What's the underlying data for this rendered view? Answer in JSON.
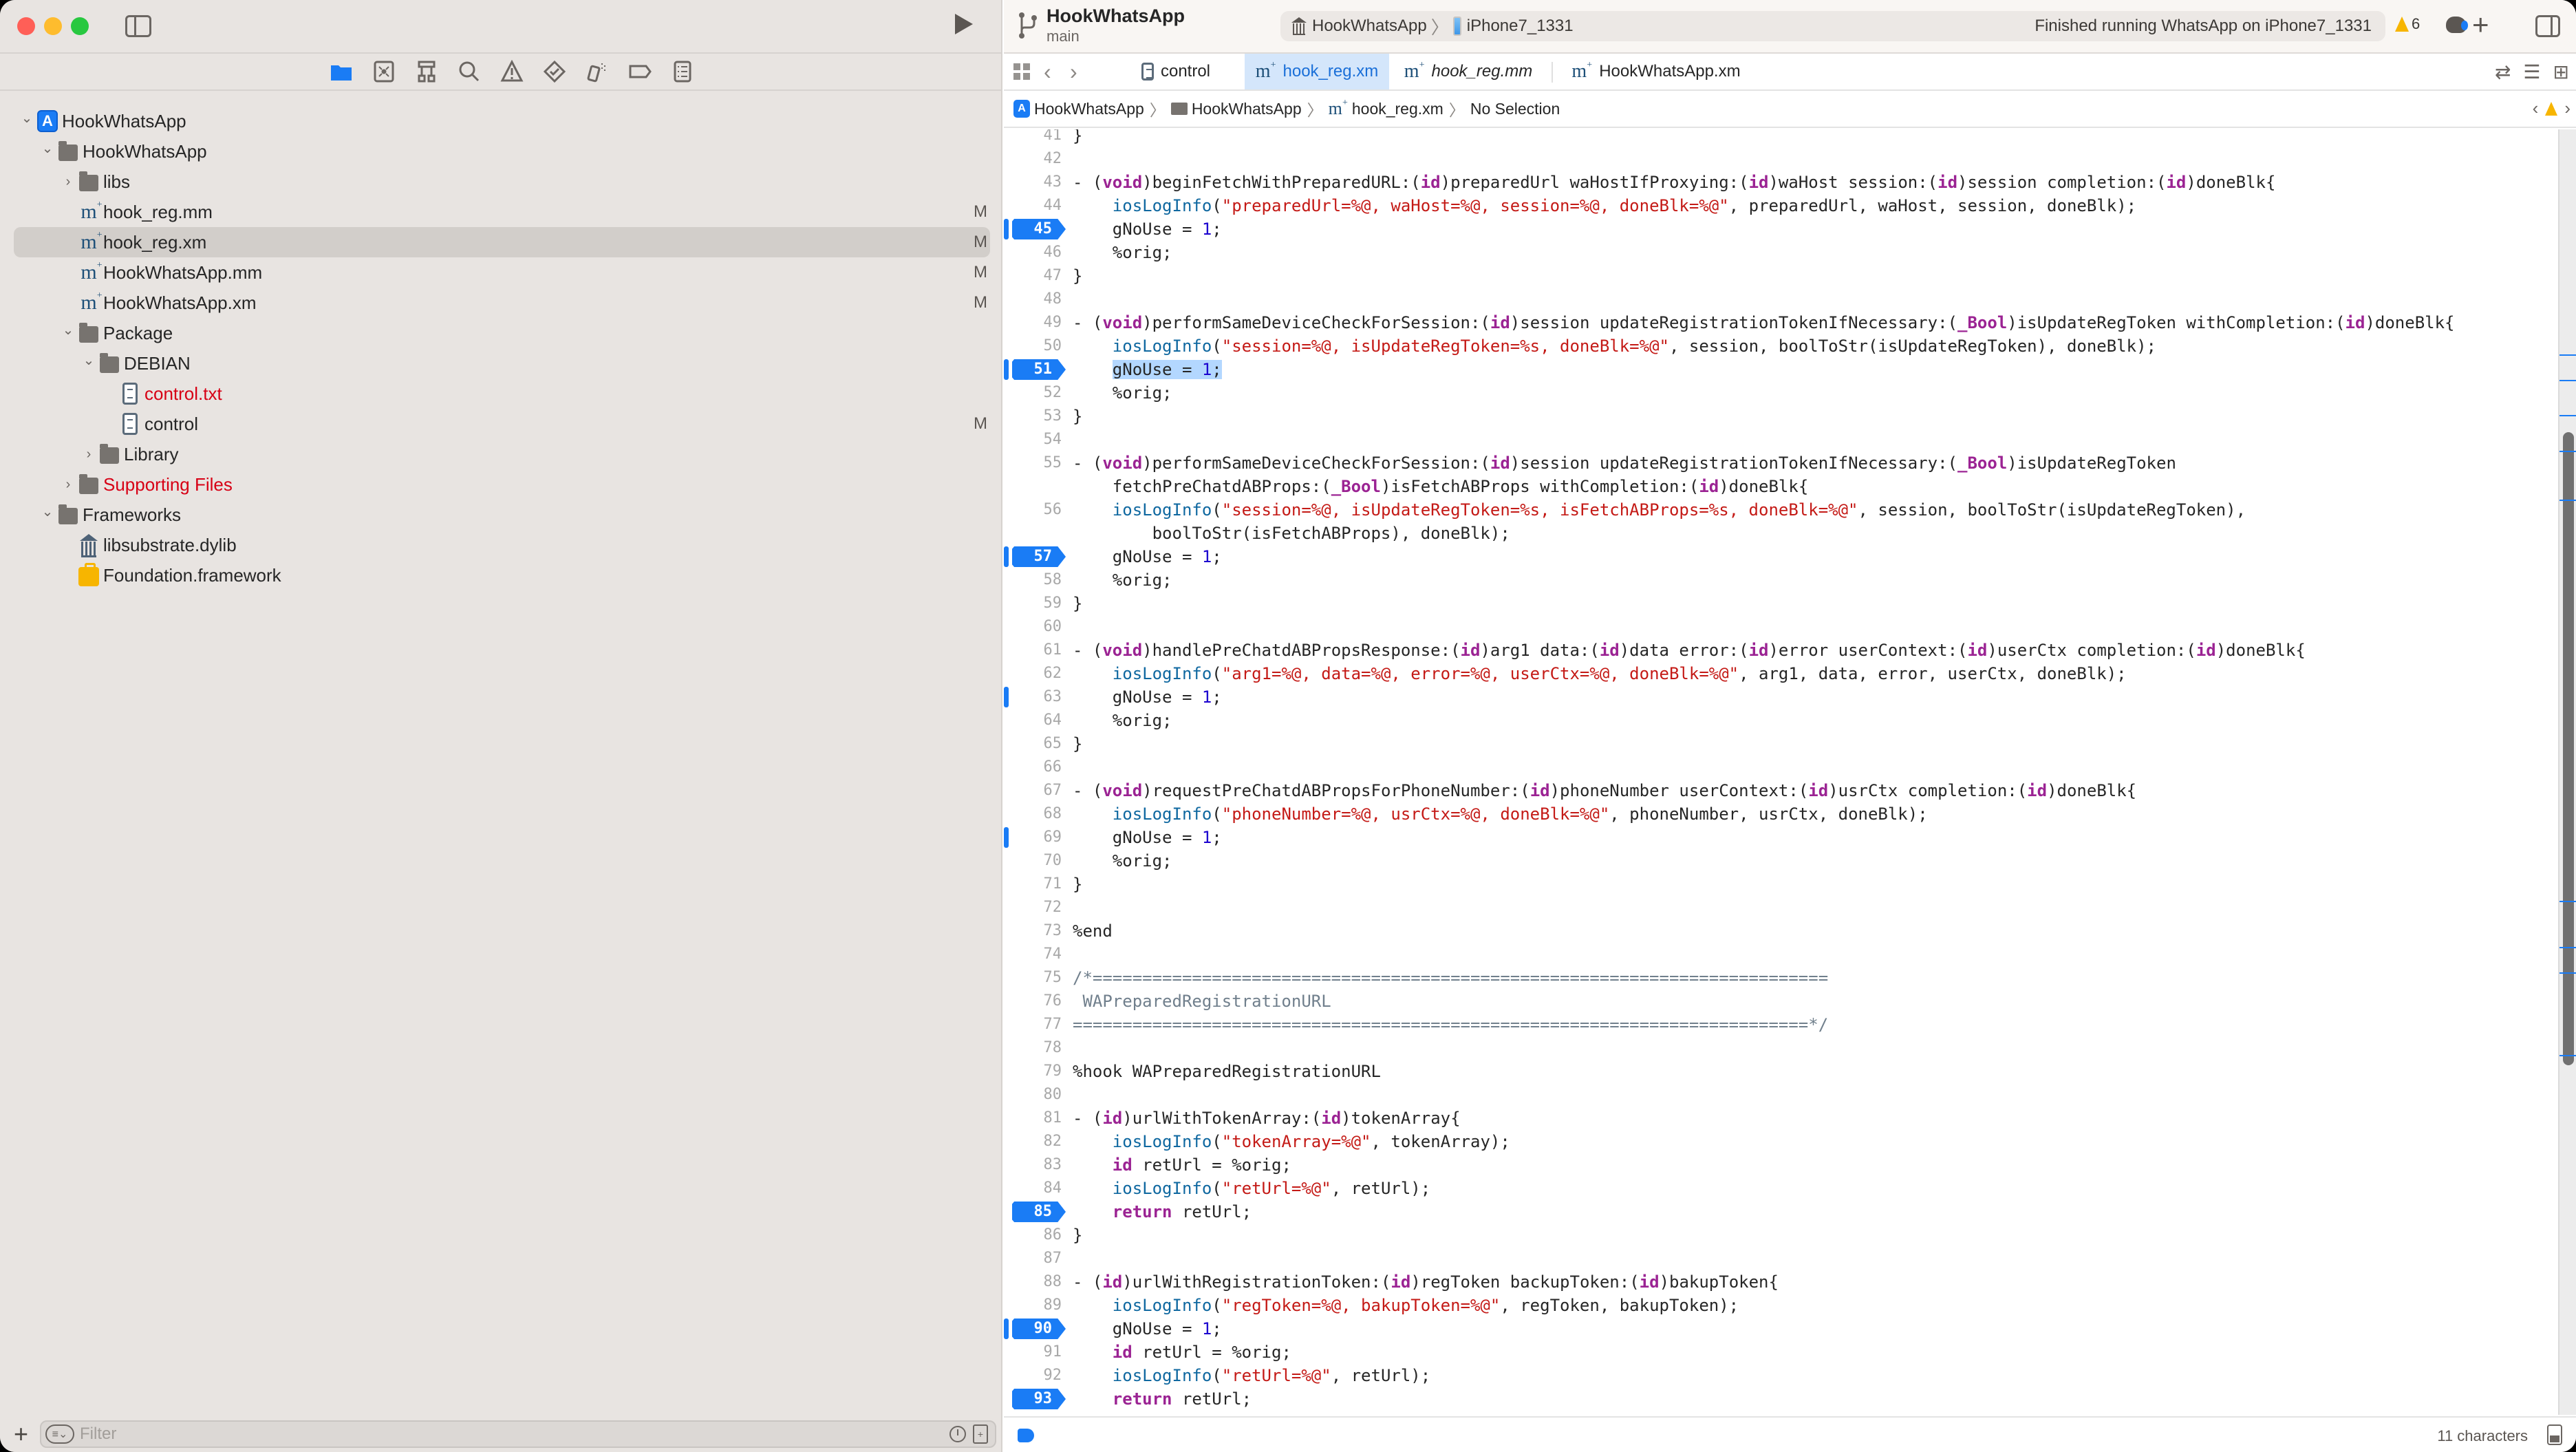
{
  "window": {
    "run_button": "Run",
    "project_title": "HookWhatsApp",
    "branch": "main"
  },
  "toolbar": {
    "scheme": "HookWhatsApp",
    "device": "iPhone7_1331",
    "status": "Finished running WhatsApp on iPhone7_1331",
    "warning_count": "6",
    "add_label": "+"
  },
  "navigator": {
    "icons": [
      "folder-icon",
      "source-control-icon",
      "symbol-hierarchy-icon",
      "search-icon",
      "warning-icon",
      "test-icon",
      "debug-icon",
      "breakpoint-icon",
      "report-icon"
    ],
    "tree": [
      {
        "label": "HookWhatsApp",
        "type": "project",
        "depth": 0,
        "expanded": true,
        "badge": ""
      },
      {
        "label": "HookWhatsApp",
        "type": "folder",
        "depth": 1,
        "expanded": true,
        "badge": ""
      },
      {
        "label": "libs",
        "type": "folder",
        "depth": 2,
        "expanded": false,
        "badge": ""
      },
      {
        "label": "hook_reg.mm",
        "type": "objc",
        "depth": 2,
        "badge": "M"
      },
      {
        "label": "hook_reg.xm",
        "type": "objc",
        "depth": 2,
        "badge": "M",
        "selected": true
      },
      {
        "label": "HookWhatsApp.mm",
        "type": "objc",
        "depth": 2,
        "badge": "M"
      },
      {
        "label": "HookWhatsApp.xm",
        "type": "objc",
        "depth": 2,
        "badge": "M"
      },
      {
        "label": "Package",
        "type": "folder",
        "depth": 2,
        "expanded": true,
        "badge": ""
      },
      {
        "label": "DEBIAN",
        "type": "folder",
        "depth": 3,
        "expanded": true,
        "badge": ""
      },
      {
        "label": "control.txt",
        "type": "doc",
        "depth": 4,
        "badge": "",
        "missing": true
      },
      {
        "label": "control",
        "type": "doc",
        "depth": 4,
        "badge": "M"
      },
      {
        "label": "Library",
        "type": "folder",
        "depth": 3,
        "expanded": false,
        "badge": ""
      },
      {
        "label": "Supporting Files",
        "type": "folder",
        "depth": 2,
        "expanded": false,
        "badge": "",
        "missing": true
      },
      {
        "label": "Frameworks",
        "type": "folder",
        "depth": 1,
        "expanded": true,
        "badge": ""
      },
      {
        "label": "libsubstrate.dylib",
        "type": "library",
        "depth": 2,
        "badge": ""
      },
      {
        "label": "Foundation.framework",
        "type": "framework",
        "depth": 2,
        "badge": ""
      }
    ],
    "filter_placeholder": "Filter"
  },
  "tabs": [
    {
      "label": "control",
      "type": "doc",
      "active": false,
      "italic": false
    },
    {
      "label": "hook_reg.xm",
      "type": "objc",
      "active": true,
      "italic": false
    },
    {
      "label": "hook_reg.mm",
      "type": "objc",
      "active": false,
      "italic": true
    },
    {
      "label": "HookWhatsApp.xm",
      "type": "objc",
      "active": false,
      "italic": false
    }
  ],
  "jumpbar": {
    "crumbs": [
      "HookWhatsApp",
      "HookWhatsApp",
      "hook_reg.xm",
      "No Selection"
    ]
  },
  "editor": {
    "lines": [
      {
        "n": "41",
        "t": "}",
        "bp": false
      },
      {
        "n": "42",
        "t": "",
        "bp": false
      },
      {
        "n": "43",
        "t": "- (void)beginFetchWithPreparedURL:(id)preparedUrl waHostIfProxying:(id)waHost session:(id)session completion:(id)doneBlk{",
        "bp": false
      },
      {
        "n": "44",
        "t": "    iosLogInfo(\"preparedUrl=%@, waHost=%@, session=%@, doneBlk=%@\", preparedUrl, waHost, session, doneBlk);",
        "bp": false
      },
      {
        "n": "45",
        "t": "    gNoUse = 1;",
        "bp": true,
        "pc": true
      },
      {
        "n": "46",
        "t": "    %orig;",
        "bp": false
      },
      {
        "n": "47",
        "t": "}",
        "bp": false
      },
      {
        "n": "48",
        "t": "",
        "bp": false
      },
      {
        "n": "49",
        "t": "- (void)performSameDeviceCheckForSession:(id)session updateRegistrationTokenIfNecessary:(_Bool)isUpdateRegToken withCompletion:(id)doneBlk{",
        "bp": false
      },
      {
        "n": "50",
        "t": "    iosLogInfo(\"session=%@, isUpdateRegToken=%s, doneBlk=%@\", session, boolToStr(isUpdateRegToken), doneBlk);",
        "bp": false
      },
      {
        "n": "51",
        "t": "    gNoUse = 1;",
        "bp": true,
        "pc": true,
        "selected": "gNoUse = 1;"
      },
      {
        "n": "52",
        "t": "    %orig;",
        "bp": false
      },
      {
        "n": "53",
        "t": "}",
        "bp": false
      },
      {
        "n": "54",
        "t": "",
        "bp": false
      },
      {
        "n": "55",
        "t": "- (void)performSameDeviceCheckForSession:(id)session updateRegistrationTokenIfNecessary:(_Bool)isUpdateRegToken",
        "bp": false
      },
      {
        "n": "",
        "t": "    fetchPreChatdABProps:(_Bool)isFetchABProps withCompletion:(id)doneBlk{",
        "bp": false
      },
      {
        "n": "56",
        "t": "    iosLogInfo(\"session=%@, isUpdateRegToken=%s, isFetchABProps=%s, doneBlk=%@\", session, boolToStr(isUpdateRegToken),",
        "bp": false
      },
      {
        "n": "",
        "t": "        boolToStr(isFetchABProps), doneBlk);",
        "bp": false
      },
      {
        "n": "57",
        "t": "    gNoUse = 1;",
        "bp": true,
        "pc": true
      },
      {
        "n": "58",
        "t": "    %orig;",
        "bp": false
      },
      {
        "n": "59",
        "t": "}",
        "bp": false
      },
      {
        "n": "60",
        "t": "",
        "bp": false
      },
      {
        "n": "61",
        "t": "- (void)handlePreChatdABPropsResponse:(id)arg1 data:(id)data error:(id)error userContext:(id)userCtx completion:(id)doneBlk{",
        "bp": false
      },
      {
        "n": "62",
        "t": "    iosLogInfo(\"arg1=%@, data=%@, error=%@, userCtx=%@, doneBlk=%@\", arg1, data, error, userCtx, doneBlk);",
        "bp": false
      },
      {
        "n": "63",
        "t": "    gNoUse = 1;",
        "bp": false,
        "pc": true
      },
      {
        "n": "64",
        "t": "    %orig;",
        "bp": false
      },
      {
        "n": "65",
        "t": "}",
        "bp": false
      },
      {
        "n": "66",
        "t": "",
        "bp": false
      },
      {
        "n": "67",
        "t": "- (void)requestPreChatdABPropsForPhoneNumber:(id)phoneNumber userContext:(id)usrCtx completion:(id)doneBlk{",
        "bp": false
      },
      {
        "n": "68",
        "t": "    iosLogInfo(\"phoneNumber=%@, usrCtx=%@, doneBlk=%@\", phoneNumber, usrCtx, doneBlk);",
        "bp": false
      },
      {
        "n": "69",
        "t": "    gNoUse = 1;",
        "bp": false,
        "pc": true
      },
      {
        "n": "70",
        "t": "    %orig;",
        "bp": false
      },
      {
        "n": "71",
        "t": "}",
        "bp": false
      },
      {
        "n": "72",
        "t": "",
        "bp": false
      },
      {
        "n": "73",
        "t": "%end",
        "bp": false
      },
      {
        "n": "74",
        "t": "",
        "bp": false
      },
      {
        "n": "75",
        "t": "/*==========================================================================",
        "bp": false,
        "comment": true
      },
      {
        "n": "76",
        "t": " WAPreparedRegistrationURL",
        "bp": false,
        "comment": true
      },
      {
        "n": "77",
        "t": "==========================================================================*/",
        "bp": false,
        "comment": true
      },
      {
        "n": "78",
        "t": "",
        "bp": false
      },
      {
        "n": "79",
        "t": "%hook WAPreparedRegistrationURL",
        "bp": false
      },
      {
        "n": "80",
        "t": "",
        "bp": false
      },
      {
        "n": "81",
        "t": "- (id)urlWithTokenArray:(id)tokenArray{",
        "bp": false
      },
      {
        "n": "82",
        "t": "    iosLogInfo(\"tokenArray=%@\", tokenArray);",
        "bp": false
      },
      {
        "n": "83",
        "t": "    id retUrl = %orig;",
        "bp": false
      },
      {
        "n": "84",
        "t": "    iosLogInfo(\"retUrl=%@\", retUrl);",
        "bp": false
      },
      {
        "n": "85",
        "t": "    return retUrl;",
        "bp": true
      },
      {
        "n": "86",
        "t": "}",
        "bp": false
      },
      {
        "n": "87",
        "t": "",
        "bp": false
      },
      {
        "n": "88",
        "t": "- (id)urlWithRegistrationToken:(id)regToken backupToken:(id)bakupToken{",
        "bp": false
      },
      {
        "n": "89",
        "t": "    iosLogInfo(\"regToken=%@, bakupToken=%@\", regToken, bakupToken);",
        "bp": false
      },
      {
        "n": "90",
        "t": "    gNoUse = 1;",
        "bp": true,
        "pc": true
      },
      {
        "n": "91",
        "t": "    id retUrl = %orig;",
        "bp": false
      },
      {
        "n": "92",
        "t": "    iosLogInfo(\"retUrl=%@\", retUrl);",
        "bp": false
      },
      {
        "n": "93",
        "t": "    return retUrl;",
        "bp": true
      }
    ],
    "scroll_markers": [
      0.175,
      0.195,
      0.222,
      0.25,
      0.288,
      0.6,
      0.636,
      0.656,
      0.72
    ]
  },
  "statusbar": {
    "selection_info": "11 characters"
  },
  "colors": {
    "accent": "#1a7cf5",
    "keyword": "#9b2393",
    "string": "#c41a16",
    "function": "#0f68a0",
    "number": "#1c00cf",
    "comment": "#707f8c",
    "missing_file": "#d70015",
    "warning": "#f7b500"
  }
}
